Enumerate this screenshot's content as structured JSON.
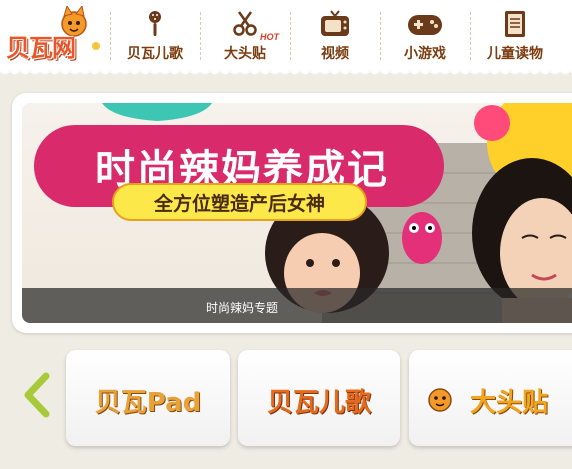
{
  "header": {
    "logo_text": "贝瓦网",
    "nav": [
      {
        "label": "贝瓦儿歌",
        "icon": "microphone-icon"
      },
      {
        "label": "大头贴",
        "icon": "scissors-icon",
        "badge": "HOT"
      },
      {
        "label": "视频",
        "icon": "tv-icon"
      },
      {
        "label": "小游戏",
        "icon": "gamepad-icon"
      },
      {
        "label": "儿童读物",
        "icon": "book-icon"
      }
    ]
  },
  "banner": {
    "title": "时尚辣妈养成记",
    "subtitle": "全方位塑造产后女神",
    "caption": "时尚辣妈专题"
  },
  "apps": {
    "prev_icon": "chevron-left-icon",
    "items": [
      {
        "label": "贝瓦Pad",
        "color": "#e8a23a"
      },
      {
        "label": "贝瓦儿歌",
        "color": "#e56b1f"
      },
      {
        "label": "大头贴",
        "color": "#f2a51e"
      }
    ]
  },
  "colors": {
    "nav_text": "#7b3c0f",
    "banner_pink": "#d92a6c",
    "banner_yellow": "#fde84a",
    "arrow_green": "#a8c93a"
  }
}
